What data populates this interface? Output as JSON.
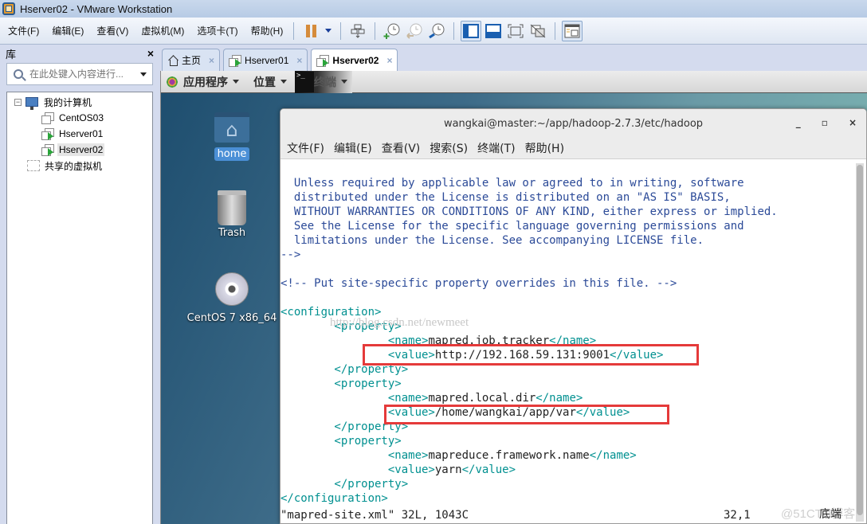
{
  "window": {
    "title": "Hserver02 - VMware Workstation"
  },
  "menubar": {
    "items": [
      "文件(F)",
      "编辑(E)",
      "查看(V)",
      "虚拟机(M)",
      "选项卡(T)",
      "帮助(H)"
    ]
  },
  "toolbar": {
    "buttons": [
      {
        "icon": "pause-icon",
        "label": "Pause"
      },
      {
        "icon": "send-ctrl-alt-del-icon",
        "label": "Send Ctrl+Alt+Del"
      },
      {
        "icon": "snapshot-take-icon",
        "label": "Take snapshot"
      },
      {
        "icon": "snapshot-revert-icon",
        "label": "Revert snapshot"
      },
      {
        "icon": "snapshot-manager-icon",
        "label": "Snapshot manager"
      },
      {
        "icon": "library-view-icon",
        "label": "Show library"
      },
      {
        "icon": "thumbnail-bar-icon",
        "label": "Thumbnail bar"
      },
      {
        "icon": "fullscreen-icon",
        "label": "Full screen"
      },
      {
        "icon": "unity-icon",
        "label": "Unity"
      },
      {
        "icon": "console-view-icon",
        "label": "Console view"
      }
    ]
  },
  "library": {
    "title": "库",
    "close": "×",
    "search_placeholder": "在此处键入内容进行...",
    "tree": {
      "root": "我的计算机",
      "expander": "−",
      "vms": [
        {
          "name": "CentOS03",
          "running": false
        },
        {
          "name": "Hserver01",
          "running": true
        },
        {
          "name": "Hserver02",
          "running": true,
          "selected": true
        }
      ],
      "shared": "共享的虚拟机"
    }
  },
  "tabs": [
    {
      "label": "主页",
      "icon": "home-icon",
      "active": false
    },
    {
      "label": "Hserver01",
      "icon": "vm-icon",
      "active": false
    },
    {
      "label": "Hserver02",
      "icon": "vm-icon",
      "active": true
    }
  ],
  "tab_close": "×",
  "guest": {
    "topbar": {
      "applications": "应用程序",
      "places": "位置",
      "terminal": "终端",
      "term_glyph": ">_"
    },
    "desktop_icons": [
      {
        "label": "home",
        "icon": "home-folder-icon"
      },
      {
        "label": "Trash",
        "icon": "trash-icon"
      },
      {
        "label": "CentOS 7 x86_64",
        "icon": "disc-icon"
      }
    ],
    "terminal": {
      "title": "wangkai@master:~/app/hadoop-2.7.3/etc/hadoop",
      "controls": {
        "minimize": "_",
        "maximize": "▫",
        "close": "×"
      },
      "menu": [
        "文件(F)",
        "编辑(E)",
        "查看(V)",
        "搜索(S)",
        "终端(T)",
        "帮助(H)"
      ],
      "lines": [
        {
          "text": "  Unless required by applicable law or agreed to in writing, software",
          "kind": "comment"
        },
        {
          "text": "  distributed under the License is distributed on an \"AS IS\" BASIS,",
          "kind": "comment"
        },
        {
          "text": "  WITHOUT WARRANTIES OR CONDITIONS OF ANY KIND, either express or implied.",
          "kind": "comment"
        },
        {
          "text": "  See the License for the specific language governing permissions and",
          "kind": "comment"
        },
        {
          "text": "  limitations under the License. See accompanying LICENSE file.",
          "kind": "comment"
        },
        {
          "text": "-->",
          "kind": "comment"
        },
        {
          "text": "",
          "kind": "blank"
        },
        {
          "text": "<!-- Put site-specific property overrides in this file. -->",
          "kind": "comment"
        },
        {
          "text": "",
          "kind": "blank"
        },
        {
          "text": "<configuration>",
          "kind": "tag"
        },
        {
          "text": "        <property>",
          "kind": "tag"
        },
        {
          "text": "                <name>mapred.job.tracker</name>",
          "kind": "element",
          "tag": "name",
          "indent": "                ",
          "value": "mapred.job.tracker"
        },
        {
          "text": "                <value>http://192.168.59.131:9001</value>",
          "kind": "element",
          "tag": "value",
          "indent": "                ",
          "value": "http://192.168.59.131:9001"
        },
        {
          "text": "        </property>",
          "kind": "tag"
        },
        {
          "text": "        <property>",
          "kind": "tag"
        },
        {
          "text": "                <name>mapred.local.dir</name>",
          "kind": "element",
          "tag": "name",
          "indent": "                ",
          "value": "mapred.local.dir"
        },
        {
          "text": "                <value>/home/wangkai/app/var</value>",
          "kind": "element",
          "tag": "value",
          "indent": "                ",
          "value": "/home/wangkai/app/var"
        },
        {
          "text": "        </property>",
          "kind": "tag"
        },
        {
          "text": "        <property>",
          "kind": "tag"
        },
        {
          "text": "                <name>mapreduce.framework.name</name>",
          "kind": "element",
          "tag": "name",
          "indent": "                ",
          "value": "mapreduce.framework.name"
        },
        {
          "text": "                <value>yarn</value>",
          "kind": "element",
          "tag": "value",
          "indent": "                ",
          "value": "yarn"
        },
        {
          "text": "        </property>",
          "kind": "tag"
        },
        {
          "text": "</configuration>",
          "kind": "tag"
        }
      ],
      "watermark": "http://blog.csdn.net/newmeet",
      "status": {
        "file_info": "\"mapred-site.xml\" 32L, 1043C",
        "cursor": "32,1",
        "position": "底端"
      },
      "corner_watermark": "@51CTO博客"
    }
  }
}
